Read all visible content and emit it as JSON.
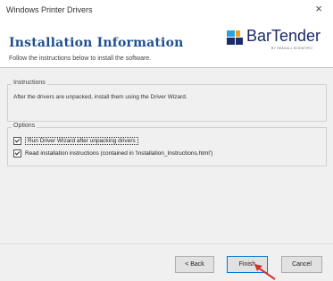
{
  "window": {
    "title": "Windows Printer Drivers",
    "close_glyph": "×"
  },
  "header": {
    "title": "Installation Information",
    "subtitle": "Follow the instructions below to install the software.",
    "logo_text": "BarTender",
    "logo_sub": "BY SEAGULL SCIENTIFIC",
    "logo_color": "#1a2b6a",
    "logo_accent_colors": [
      "#2aa3dc",
      "#f0a020"
    ]
  },
  "instructions": {
    "group_label": "Instructions",
    "text": "After the drivers are unpacked, install them using the Driver Wizard."
  },
  "options": {
    "group_label": "Options",
    "items": [
      {
        "label": "Run Driver Wizard after unpacking drivers",
        "checked": true
      },
      {
        "label": "Read installation instructions (contained in 'Installation_Instructions.html')",
        "checked": true
      }
    ]
  },
  "buttons": {
    "back": "< Back",
    "finish": "Finish",
    "cancel": "Cancel"
  },
  "icons": {
    "close": "close-icon",
    "logo": "bartender-logo-icon",
    "pointer": "arrow-cursor-icon"
  },
  "colors": {
    "title_blue": "#1f4f8f",
    "pointer_red": "#d9302b",
    "focus_border": "#0078d7"
  }
}
